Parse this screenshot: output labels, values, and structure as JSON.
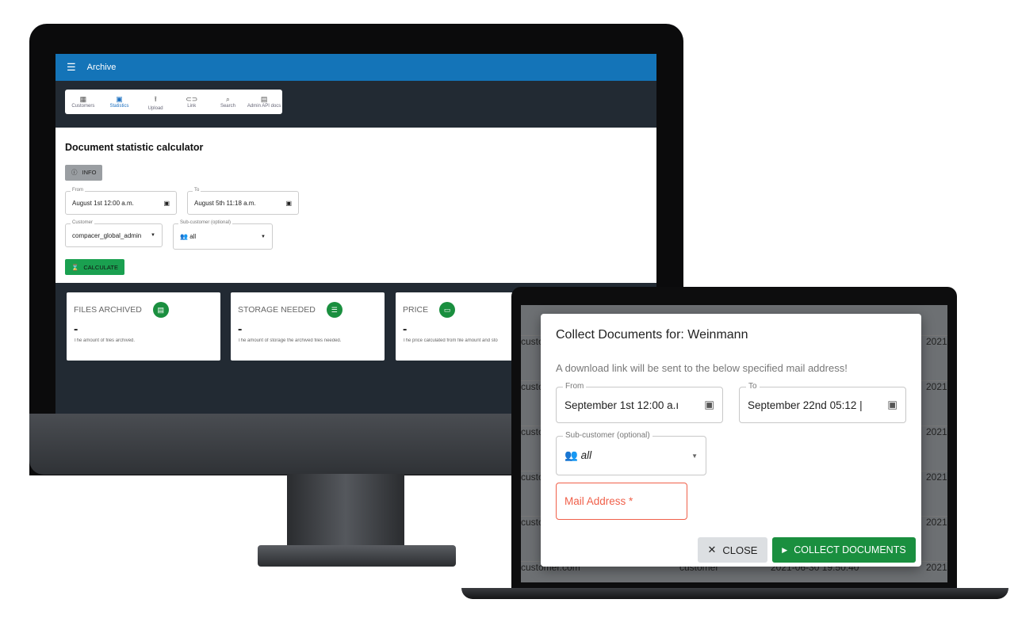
{
  "monitor": {
    "appbar": {
      "title": "Archive",
      "menu_icon": "menu-icon"
    },
    "nav": [
      {
        "label": "Customers",
        "icon": "table-icon"
      },
      {
        "label": "Statistics",
        "icon": "bar-chart-icon",
        "active": true
      },
      {
        "label": "Upload",
        "icon": "upload-icon"
      },
      {
        "label": "Link",
        "icon": "link-icon"
      },
      {
        "label": "Search",
        "icon": "search-icon"
      },
      {
        "label": "Admin API docs",
        "icon": "document-icon"
      }
    ],
    "page_title": "Document statistic calculator",
    "info_label": "INFO",
    "from": {
      "label": "From",
      "value": "August 1st 12:00 a.m."
    },
    "to": {
      "label": "To",
      "value": "August 5th 11:18 a.m."
    },
    "customer": {
      "label": "Customer",
      "value": "compacer_global_admin"
    },
    "subcustomer": {
      "label": "Sub-customer (optional)",
      "value": "all"
    },
    "calculate_label": "CALCULATE",
    "cards": [
      {
        "title": "FILES ARCHIVED",
        "value": "-",
        "desc": "The amount of files archived."
      },
      {
        "title": "STORAGE NEEDED",
        "value": "-",
        "desc": "The amount of storage the archived files needed."
      },
      {
        "title": "PRICE",
        "value": "-",
        "desc": "The price calculated from file amount and sto"
      }
    ],
    "accent": "#1a8f3f",
    "appbar_color": "#1474b8"
  },
  "laptop": {
    "background_rows": [
      {
        "left": "custo",
        "right": "2021"
      },
      {
        "left": "custo",
        "right": "2021"
      },
      {
        "left": "custo",
        "right": "2021"
      },
      {
        "left": "custo",
        "right": "2021"
      },
      {
        "left": "custo",
        "right": "2021"
      },
      {
        "left": "customer.com",
        "mid": "customer",
        "date": "2021-06-30 19:50:40",
        "right": "2021"
      }
    ],
    "modal": {
      "title": "Collect Documents for: Weinmann",
      "hint": "A download link will be sent to the below specified mail address!",
      "from": {
        "label": "From",
        "value": "September 1st 12:00 a.ı"
      },
      "to": {
        "label": "To",
        "value": "September 22nd 05:12 |"
      },
      "subcustomer": {
        "label": "Sub-customer (optional)",
        "value": "all"
      },
      "mail": {
        "placeholder": "Mail Address *"
      },
      "close_label": "CLOSE",
      "collect_label": "COLLECT DOCUMENTS",
      "error_color": "#f0604a"
    }
  }
}
